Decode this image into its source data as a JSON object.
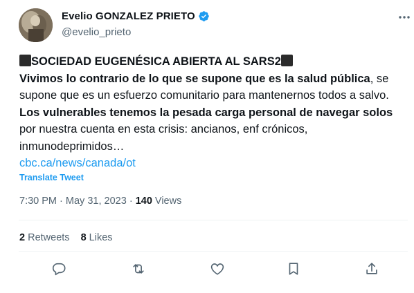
{
  "author": {
    "name": "Evelio GONZALEZ PRIETO",
    "handle": "@evelio_prieto"
  },
  "tweet": {
    "title_line": "SOCIEDAD EUGENÉSICA ABIERTA AL SARS2",
    "p1_bold": "Vivimos lo contrario de lo que se supone que es la salud pública",
    "p1_rest": ", se supone que es un esfuerzo comunitario para mantenernos todos a salvo.",
    "p2_bold": "Los vulnerables tenemos la pesada carga personal de navegar solos",
    "p2_rest": " por nuestra cuenta en esta crisis: ancianos, enf crónicos, inmunodeprimidos…",
    "link": "cbc.ca/news/canada/ot",
    "translate": "Translate Tweet"
  },
  "meta": {
    "time": "7:30 PM",
    "separator": "·",
    "date": "May 31, 2023",
    "views_count": "140",
    "views_label": "Views"
  },
  "stats": {
    "retweets_count": "2",
    "retweets_label": "Retweets",
    "likes_count": "8",
    "likes_label": "Likes"
  },
  "icons": {
    "verified": "verified-badge-icon",
    "more": "more-icon",
    "reply": "reply-icon",
    "retweet": "retweet-icon",
    "like": "like-icon",
    "bookmark": "bookmark-icon",
    "share": "share-icon"
  },
  "colors": {
    "accent": "#1d9bf0",
    "text": "#0f1419",
    "secondary": "#536471"
  }
}
